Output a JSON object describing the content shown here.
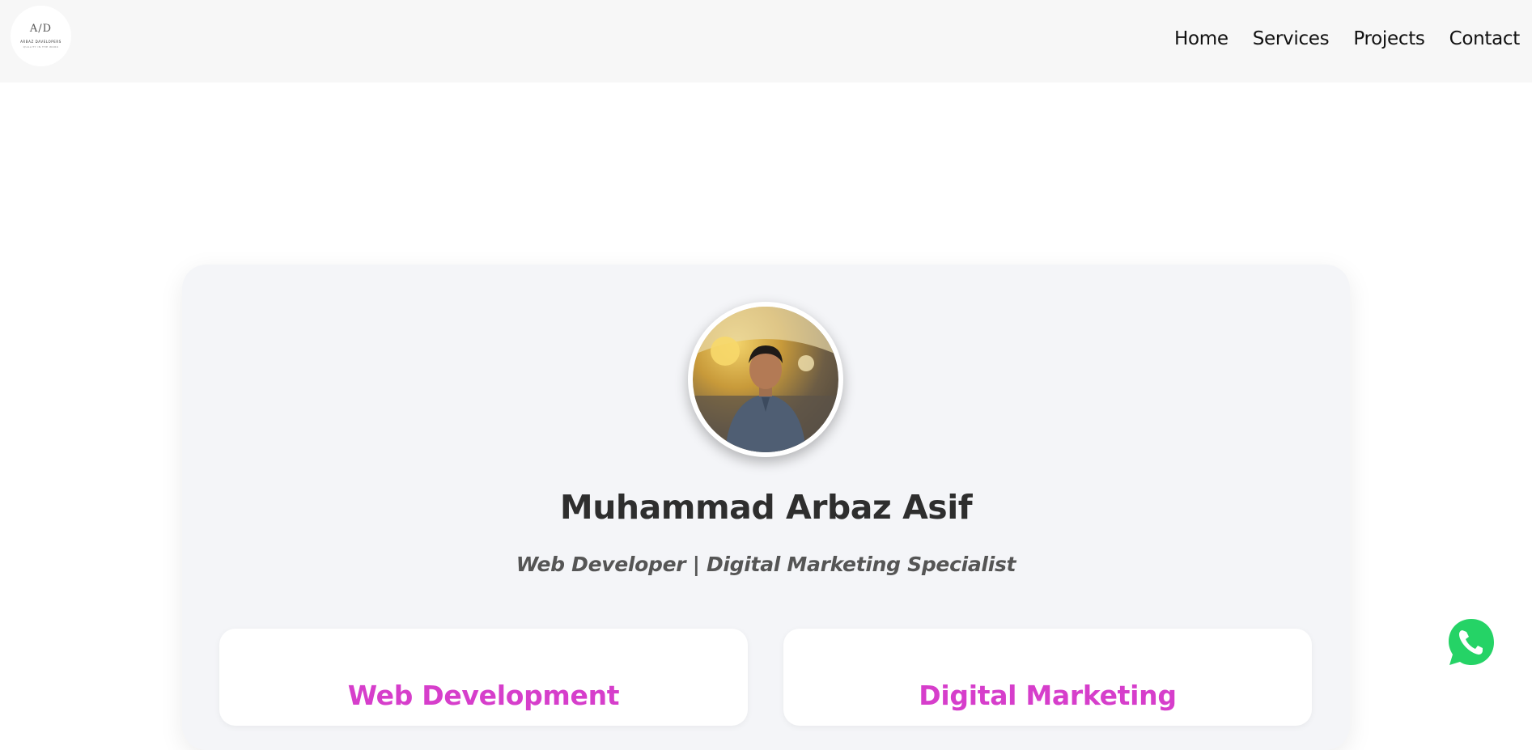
{
  "header": {
    "logo": {
      "mark": "A/D",
      "name": "ARBAZ DAVELOPERS",
      "tagline": "QUALITY IN THE WORK"
    },
    "nav": [
      {
        "label": "Home"
      },
      {
        "label": "Services"
      },
      {
        "label": "Projects"
      },
      {
        "label": "Contact"
      }
    ]
  },
  "profile": {
    "name": "Muhammad Arbaz Asif",
    "tagline": "Web Developer | Digital Marketing Specialist"
  },
  "services": [
    {
      "title": "Web Development"
    },
    {
      "title": "Digital Marketing"
    }
  ],
  "colors": {
    "accent": "#d63ecb",
    "whatsapp": "#25d366"
  },
  "icons": {
    "chat": "whatsapp-icon"
  }
}
